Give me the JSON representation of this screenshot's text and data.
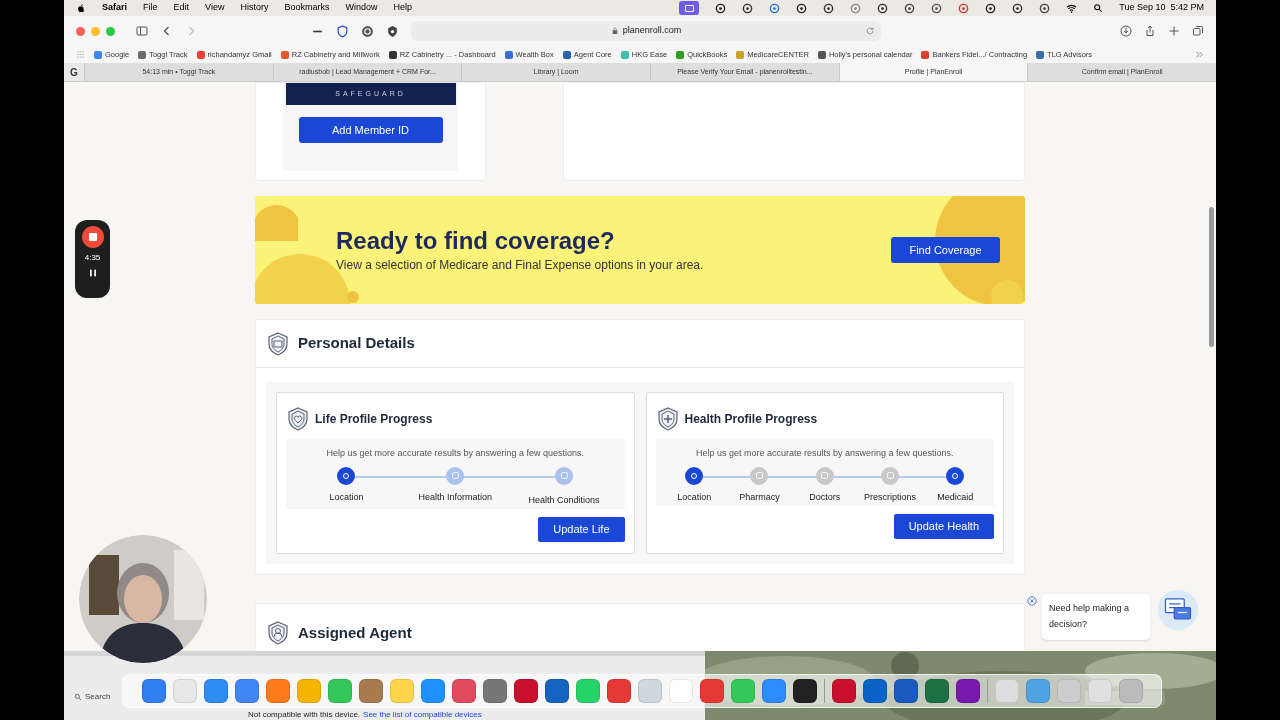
{
  "menu_bar": {
    "app": "Safari",
    "items": [
      "File",
      "Edit",
      "View",
      "History",
      "Bookmarks",
      "Window",
      "Help"
    ],
    "clock": "Tue Sep 10  5:42 PM"
  },
  "browser": {
    "address": "planenroll.com",
    "bookmarks": [
      {
        "label": "Google",
        "color": "#4285f4"
      },
      {
        "label": "Toggl Track",
        "color": "#6b6b6b"
      },
      {
        "label": "richandamyz Gmail",
        "color": "#ea4335"
      },
      {
        "label": "RZ Cabinetry and Millwork",
        "color": "#e4572e"
      },
      {
        "label": "RZ Cabinetry ... - Dashboard",
        "color": "#333333"
      },
      {
        "label": "Wealth Box",
        "color": "#3b6fd6"
      },
      {
        "label": "Agent Core",
        "color": "#2a64b0"
      },
      {
        "label": "HKG Ease",
        "color": "#3cbfae"
      },
      {
        "label": "QuickBooks",
        "color": "#2ca01c"
      },
      {
        "label": "MedicareCENTER",
        "color": "#c9a227"
      },
      {
        "label": "Holly's personal calendar",
        "color": "#555555"
      },
      {
        "label": "Bankers Fidel.../ Contracting",
        "color": "#d9412b"
      },
      {
        "label": "TLG Advisors",
        "color": "#3a6ea5"
      }
    ],
    "pinned_tab": "G",
    "tabs": [
      {
        "label": "54:13 min • Toggl Track",
        "selected": false
      },
      {
        "label": "radiusbob | Lead Management + CRM For...",
        "selected": false
      },
      {
        "label": "Library | Loom",
        "selected": false
      },
      {
        "label": "Please Verify Your Email - planenrolltestin...",
        "selected": false
      },
      {
        "label": "Profile | PlanEnroll",
        "selected": true
      },
      {
        "label": "Confirm email | PlanEnroll",
        "selected": false
      }
    ]
  },
  "page": {
    "member_card": {
      "logo": "SAFEGUARD",
      "button": "Add Member ID"
    },
    "banner": {
      "title": "Ready to find coverage?",
      "subtitle": "View a selection of Medicare and Final Expense options in your area.",
      "button": "Find Coverage"
    },
    "personal_details": {
      "title": "Personal Details",
      "cards": [
        {
          "title": "Life Profile Progress",
          "hint": "Help us get more accurate results by answering a few questions.",
          "button": "Update Life",
          "steps": [
            {
              "label": "Location",
              "completed": true,
              "disabled": false
            },
            {
              "label": "Health Information",
              "completed": false,
              "disabled": false
            },
            {
              "label": "Health Conditions",
              "completed": false,
              "disabled": false
            }
          ]
        },
        {
          "title": "Health Profile Progress",
          "hint": "Help us get more accurate results by answering a few questions.",
          "button": "Update Health",
          "steps": [
            {
              "label": "Location",
              "completed": true,
              "disabled": false
            },
            {
              "label": "Pharmacy",
              "completed": false,
              "disabled": true
            },
            {
              "label": "Doctors",
              "completed": false,
              "disabled": true
            },
            {
              "label": "Prescriptions",
              "completed": false,
              "disabled": true
            },
            {
              "label": "Medicaid",
              "completed": true,
              "disabled": false
            }
          ]
        }
      ]
    },
    "assigned_agent": {
      "title": "Assigned Agent"
    },
    "chat_prompt": "Need help making a decision?"
  },
  "recorder": {
    "time": "4:35"
  },
  "dock": {
    "search": "Search",
    "notice": "Not compatible with this device.",
    "notice_link": "See the list of compatible devices"
  }
}
